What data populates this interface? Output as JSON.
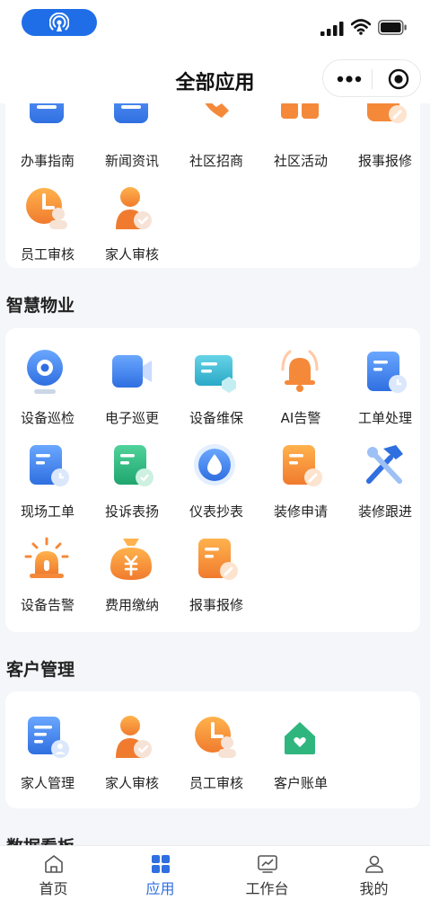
{
  "nav": {
    "title": "全部应用"
  },
  "top_section": {
    "items": [
      {
        "label": "办事指南",
        "icon": "guide-icon"
      },
      {
        "label": "新闻资讯",
        "icon": "news-icon"
      },
      {
        "label": "社区招商",
        "icon": "phone-icon"
      },
      {
        "label": "社区活动",
        "icon": "activity-icon"
      },
      {
        "label": "报事报修",
        "icon": "report-repair-icon"
      },
      {
        "label": "员工审核",
        "icon": "staff-review-icon"
      },
      {
        "label": "家人审核",
        "icon": "family-review-icon"
      }
    ]
  },
  "smart_property": {
    "title": "智慧物业",
    "items": [
      {
        "label": "设备巡检",
        "icon": "camera-icon"
      },
      {
        "label": "电子巡更",
        "icon": "video-icon"
      },
      {
        "label": "设备维保",
        "icon": "maintenance-icon"
      },
      {
        "label": "AI告警",
        "icon": "bell-icon"
      },
      {
        "label": "工单处理",
        "icon": "work-order-icon"
      },
      {
        "label": "现场工单",
        "icon": "onsite-order-icon"
      },
      {
        "label": "投诉表扬",
        "icon": "complaint-icon"
      },
      {
        "label": "仪表抄表",
        "icon": "water-meter-icon"
      },
      {
        "label": "装修申请",
        "icon": "renovation-apply-icon"
      },
      {
        "label": "装修跟进",
        "icon": "tools-icon"
      },
      {
        "label": "设备告警",
        "icon": "alarm-light-icon"
      },
      {
        "label": "费用缴纳",
        "icon": "money-bag-icon"
      },
      {
        "label": "报事报修",
        "icon": "report-repair-icon"
      }
    ]
  },
  "customer_mgmt": {
    "title": "客户管理",
    "items": [
      {
        "label": "家人管理",
        "icon": "family-manage-icon"
      },
      {
        "label": "家人审核",
        "icon": "family-review-icon"
      },
      {
        "label": "员工审核",
        "icon": "staff-review-icon"
      },
      {
        "label": "客户账单",
        "icon": "house-icon"
      }
    ]
  },
  "data_section": {
    "title": "数据看板"
  },
  "tabbar": [
    {
      "label": "首页",
      "icon": "home-icon",
      "active": false
    },
    {
      "label": "应用",
      "icon": "apps-icon",
      "active": true
    },
    {
      "label": "工作台",
      "icon": "chart-icon",
      "active": false
    },
    {
      "label": "我的",
      "icon": "user-icon",
      "active": false
    }
  ],
  "colors": {
    "primary": "#2f6fe0",
    "orange": "#f39b34",
    "green": "#2fb67f"
  }
}
